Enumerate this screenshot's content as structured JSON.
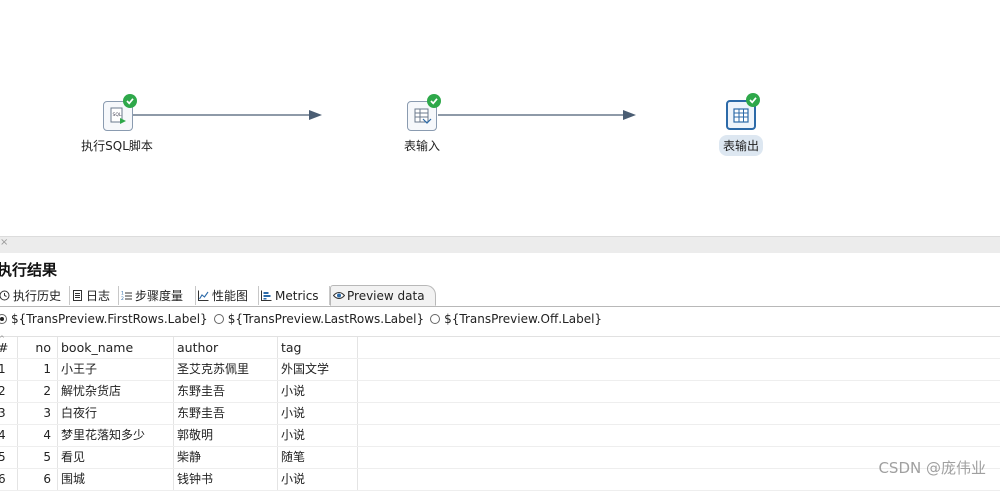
{
  "canvas": {
    "steps": [
      {
        "label": "执行SQL脚本"
      },
      {
        "label": "表输入"
      },
      {
        "label": "表输出"
      }
    ]
  },
  "panel": {
    "title": "执行结果",
    "tabs": [
      {
        "label": "执行历史",
        "icon": "history-icon"
      },
      {
        "label": "日志",
        "icon": "log-icon"
      },
      {
        "label": "步骤度量",
        "icon": "step-metrics-icon"
      },
      {
        "label": "性能图",
        "icon": "performance-chart-icon"
      },
      {
        "label": "Metrics",
        "icon": "metrics-icon"
      },
      {
        "label": "Preview data",
        "icon": "eye-icon",
        "active": true
      }
    ],
    "preview_options": [
      {
        "label": "${TransPreview.FirstRows.Label}",
        "selected": true
      },
      {
        "label": "${TransPreview.LastRows.Label}",
        "selected": false
      },
      {
        "label": "${TransPreview.Off.Label}",
        "selected": false
      }
    ]
  },
  "table": {
    "columns": [
      "#",
      "no",
      "book_name",
      "author",
      "tag"
    ],
    "rows": [
      [
        "1",
        "1",
        "小王子",
        "圣艾克苏佩里",
        "外国文学"
      ],
      [
        "2",
        "2",
        "解忧杂货店",
        "东野圭吾",
        "小说"
      ],
      [
        "3",
        "3",
        "白夜行",
        "东野圭吾",
        "小说"
      ],
      [
        "4",
        "4",
        "梦里花落知多少",
        "郭敬明",
        "小说"
      ],
      [
        "5",
        "5",
        "看见",
        "柴静",
        "随笔"
      ],
      [
        "6",
        "6",
        "围城",
        "钱钟书",
        "小说"
      ]
    ]
  },
  "watermark": "CSDN @庞伟业",
  "colors": {
    "link": "#4a5d73",
    "ok": "#2ea84a",
    "selected_border": "#2c6aa8"
  }
}
